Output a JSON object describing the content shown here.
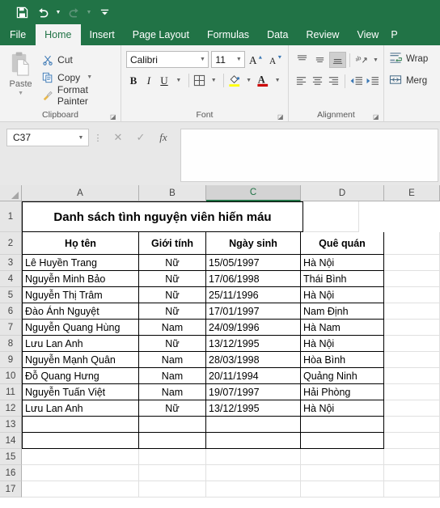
{
  "quick_access": {
    "items": [
      {
        "name": "save-button",
        "icon": "save-icon"
      },
      {
        "name": "undo-button",
        "icon": "undo-icon",
        "has_caret": true,
        "disabled": false
      },
      {
        "name": "redo-button",
        "icon": "redo-icon",
        "has_caret": true,
        "disabled": true
      },
      {
        "name": "customize-quick-access-toolbar-button",
        "icon": "chevron-down-bar-icon"
      }
    ]
  },
  "ribbon": {
    "tabs": [
      {
        "label": "File",
        "active": false
      },
      {
        "label": "Home",
        "active": true
      },
      {
        "label": "Insert",
        "active": false
      },
      {
        "label": "Page Layout",
        "active": false
      },
      {
        "label": "Formulas",
        "active": false
      },
      {
        "label": "Data",
        "active": false
      },
      {
        "label": "Review",
        "active": false
      },
      {
        "label": "View",
        "active": false
      },
      {
        "label": "P",
        "active": false
      }
    ],
    "clipboard": {
      "group_label": "Clipboard",
      "paste_label": "Paste",
      "cut_label": "Cut",
      "copy_label": "Copy",
      "format_painter_label": "Format Painter"
    },
    "font": {
      "group_label": "Font",
      "font_name": "Calibri",
      "font_size": "11",
      "bold_label": "B",
      "italic_label": "I",
      "underline_label": "U",
      "increase_font_label": "A",
      "decrease_font_label": "A",
      "highlight_color": "#ffff00",
      "font_color": "#cc0000"
    },
    "alignment": {
      "group_label": "Alignment",
      "wrap_text_label": "Wrap",
      "merge_label": "Merg"
    }
  },
  "formula_bar": {
    "name_box_value": "C37",
    "cancel_label": "✕",
    "enter_label": "✓",
    "insert_function_label": "fx",
    "formula_value": "",
    "formula_placeholder": ""
  },
  "sheet": {
    "columns": [
      "A",
      "B",
      "C",
      "D",
      "E"
    ],
    "selected_column": "C",
    "selected_cell": "C37",
    "rows": [
      "1",
      "2",
      "3",
      "4",
      "5",
      "6",
      "7",
      "8",
      "9",
      "10",
      "11",
      "12",
      "13",
      "14",
      "15",
      "16",
      "17"
    ],
    "title": "Danh sách tình nguyện viên hiến máu",
    "headers": [
      "Họ tên",
      "Giới tính",
      "Ngày sinh",
      "Quê quán"
    ],
    "data": [
      {
        "row": "3",
        "name": "Lê Huyền Trang",
        "gender": "Nữ",
        "dob": "15/05/1997",
        "hometown": "Hà Nội"
      },
      {
        "row": "4",
        "name": "Nguyễn Minh Bảo",
        "gender": "Nữ",
        "dob": "17/06/1998",
        "hometown": "Thái Bình"
      },
      {
        "row": "5",
        "name": "Nguyễn Thị Trâm",
        "gender": "Nữ",
        "dob": "25/11/1996",
        "hometown": "Hà Nội"
      },
      {
        "row": "6",
        "name": "Đào Ánh Nguyệt",
        "gender": "Nữ",
        "dob": "17/01/1997",
        "hometown": "Nam Định"
      },
      {
        "row": "7",
        "name": "Nguyễn Quang Hùng",
        "gender": "Nam",
        "dob": "24/09/1996",
        "hometown": "Hà Nam"
      },
      {
        "row": "8",
        "name": "Lưu Lan Anh",
        "gender": "Nữ",
        "dob": "13/12/1995",
        "hometown": "Hà Nội"
      },
      {
        "row": "9",
        "name": "Nguyễn Mạnh Quân",
        "gender": "Nam",
        "dob": "28/03/1998",
        "hometown": "Hòa Bình"
      },
      {
        "row": "10",
        "name": "Đỗ Quang Hưng",
        "gender": "Nam",
        "dob": "20/11/1994",
        "hometown": "Quảng Ninh"
      },
      {
        "row": "11",
        "name": "Nguyễn Tuấn Việt",
        "gender": "Nam",
        "dob": "19/07/1997",
        "hometown": "Hải Phòng"
      },
      {
        "row": "12",
        "name": "Lưu Lan Anh",
        "gender": "Nữ",
        "dob": "13/12/1995",
        "hometown": "Hà Nội"
      },
      {
        "row": "13",
        "name": "",
        "gender": "",
        "dob": "",
        "hometown": ""
      },
      {
        "row": "14",
        "name": "",
        "gender": "",
        "dob": "",
        "hometown": ""
      }
    ],
    "empty_rows": [
      "15",
      "16",
      "17"
    ]
  },
  "colors": {
    "excel_green": "#217346",
    "ribbon_bg": "#f3f3f3",
    "header_bg": "#e6e6e6"
  }
}
